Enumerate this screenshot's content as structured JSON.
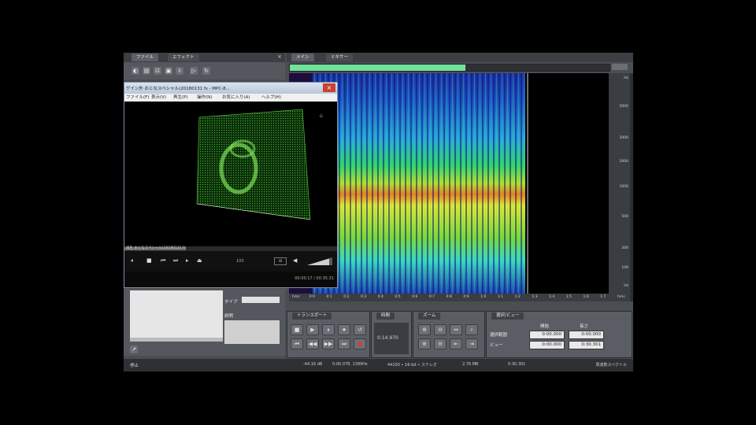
{
  "left_tabs": [
    "ファイル",
    "エフェクト"
  ],
  "right_tabs": [
    "メイン",
    "ミキサー"
  ],
  "player": {
    "title": "ゲイン外 おとなスペシャル(20180131 fs - MPC-8...",
    "menu": [
      "ファイル(F)",
      "表示(V)",
      "再生(P)",
      "操作(N)",
      "お気に入り(A)",
      "ヘルプ(H)"
    ],
    "status_file": "再生 おとなスペシャル(20180131 fs",
    "time": "00:00:17 / 00:35:31",
    "corner_glyph": "⌂",
    "rate_label": "100"
  },
  "spectrogram": {
    "y_ticks": [
      "Hz",
      "5000",
      "3000",
      "2000",
      "1000",
      "500",
      "200",
      "100",
      "Hz"
    ],
    "x_ticks": [
      "hms",
      "0:0",
      "0:1",
      "0:2",
      "0:3",
      "0:4",
      "0:5",
      "0:6",
      "0:7",
      "0:8",
      "0:9",
      "1:0",
      "1:1",
      "1:2",
      "1:3",
      "1:4",
      "1:5",
      "1:6",
      "1:7",
      "hms"
    ],
    "progress": 0.55
  },
  "left_panel": {
    "type_label": "タイプ",
    "desc_label": "説明"
  },
  "transport": {
    "title": "トランスポート",
    "buttons": [
      "■",
      "▶",
      "⏸",
      "⏺",
      "⏮",
      "◀◀",
      "▶▶",
      "⏭",
      "↺",
      "●"
    ]
  },
  "time_panel": {
    "title": "時間",
    "value": "0:14.970"
  },
  "zoom": {
    "title": "ズーム"
  },
  "selection": {
    "title": "選択/ビュー",
    "col_start": "開始",
    "col_end": "長さ",
    "row_select": "選択範囲",
    "row_view": "ビュー",
    "select_start": "0:00.000",
    "select_end": "0:00.000",
    "view_start": "0:00.000",
    "view_end": "0:30.301"
  },
  "status_bar": {
    "left": "停止",
    "level": "-44.16 dB",
    "position": "0:00.078, 1399Hz",
    "format": "44100 • 16-bit • ステレオ",
    "size": "2.76 MB",
    "duration": "0:30.301",
    "free": "周波数スペクトル"
  }
}
